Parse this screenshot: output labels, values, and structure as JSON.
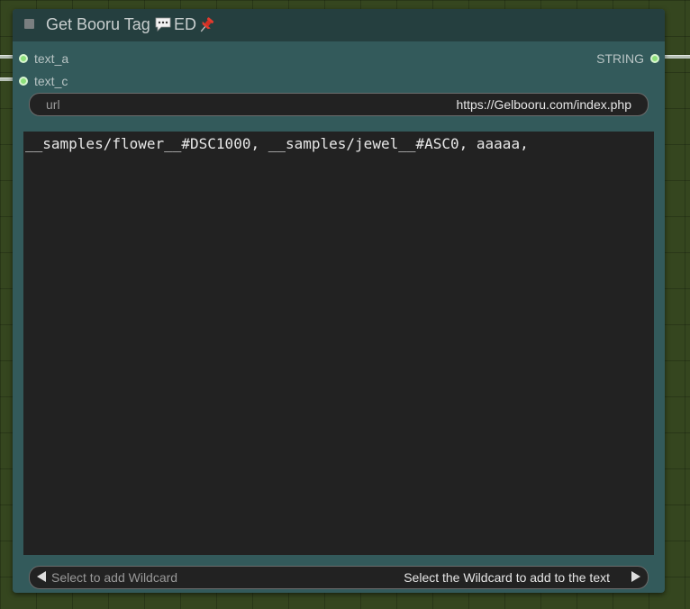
{
  "node": {
    "title": "Get Booru Tag",
    "badge_text": "ED",
    "speech_icon": "speech-bubble-icon",
    "pin_icon": "pushpin-icon"
  },
  "inputs": [
    {
      "name": "text_a"
    },
    {
      "name": "text_c"
    }
  ],
  "outputs": [
    {
      "name": "STRING"
    }
  ],
  "url_widget": {
    "label": "url",
    "value": "https://Gelbooru.com/index.php"
  },
  "text_widget": {
    "value": "__samples/flower__#DSC1000, __samples/jewel__#ASC0, aaaaa,"
  },
  "wildcard_widget": {
    "label": "Select to add Wildcard",
    "value": "Select the Wildcard to add to the text"
  },
  "colors": {
    "canvas_bg": "#35461f",
    "node_body": "#335a5b",
    "node_header": "#253f3f",
    "slot_connected": "#8de07b",
    "widget_bg": "#222222"
  }
}
